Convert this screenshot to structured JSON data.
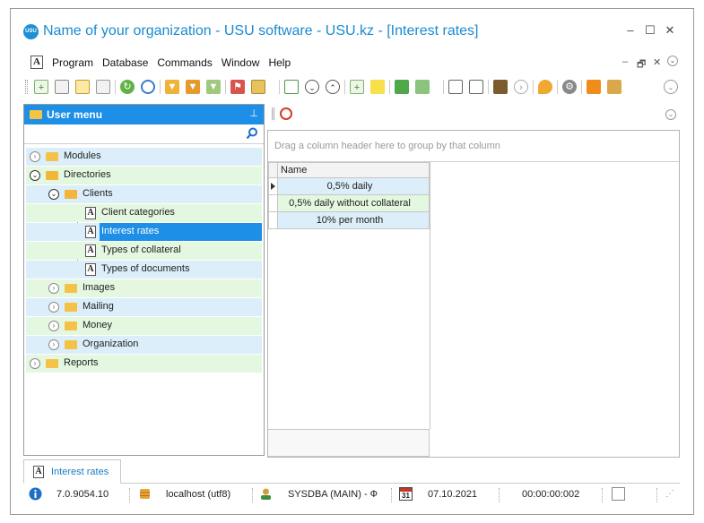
{
  "window": {
    "title": "Name of your organization - USU software - USU.kz - [Interest rates]",
    "logo_text": "USU",
    "controls": {
      "minimize": "–",
      "maximize": "☐",
      "close": "✕"
    }
  },
  "menu": {
    "doc_icon": "A",
    "items": [
      "Program",
      "Database",
      "Commands",
      "Window",
      "Help"
    ],
    "mdi_controls": {
      "minimize": "–",
      "restore": "🗗",
      "close": "✕",
      "extra": "⌄"
    }
  },
  "toolbar": {
    "icons": [
      "add-icon",
      "copy-icon",
      "edit-icon",
      "delete-icon",
      "refresh-icon",
      "search-icon",
      "filter-icon",
      "filter-clear-icon",
      "filter-settings-icon",
      "flag-icon",
      "image-icon",
      "columns-icon",
      "expand-all-icon",
      "collapse-all-icon",
      "add-child-icon",
      "note-icon",
      "export-icon",
      "import-icon",
      "new-window-icon",
      "close-window-icon",
      "exit-icon",
      "forward-icon",
      "location-icon",
      "settings-icon",
      "rss-icon",
      "users-icon"
    ]
  },
  "user_menu": {
    "title": "User menu",
    "pin": "📌",
    "items": [
      {
        "label": "Modules",
        "level": 0,
        "type": "folder",
        "expanded": false
      },
      {
        "label": "Directories",
        "level": 0,
        "type": "folder",
        "expanded": true
      },
      {
        "label": "Clients",
        "level": 1,
        "type": "folder",
        "expanded": true
      },
      {
        "label": "Client categories",
        "level": 2,
        "type": "doc"
      },
      {
        "label": "Interest rates",
        "level": 2,
        "type": "doc",
        "selected": true
      },
      {
        "label": "Types of collateral",
        "level": 2,
        "type": "doc"
      },
      {
        "label": "Types of documents",
        "level": 2,
        "type": "doc"
      },
      {
        "label": "Images",
        "level": 1,
        "type": "folder",
        "expanded": false
      },
      {
        "label": "Mailing",
        "level": 1,
        "type": "folder",
        "expanded": false
      },
      {
        "label": "Money",
        "level": 1,
        "type": "folder",
        "expanded": false
      },
      {
        "label": "Organization",
        "level": 1,
        "type": "folder",
        "expanded": false
      },
      {
        "label": "Reports",
        "level": 0,
        "type": "folder",
        "expanded": false
      }
    ]
  },
  "grid": {
    "group_hint": "Drag a column header here to group by that column",
    "column": "Name",
    "rows": [
      "0,5% daily",
      "0,5% daily without collateral",
      "10% per month"
    ]
  },
  "doc_tab": {
    "label": "Interest rates",
    "icon": "A"
  },
  "status": {
    "version": "7.0.9054.10",
    "server": "localhost (utf8)",
    "user": "SYSDBA (MAIN) - Ф",
    "date": "07.10.2021",
    "timer": "00:00:00:002",
    "calendar_day": "31"
  },
  "colors": {
    "accent": "#1d8fe6",
    "title_text": "#1a8bd0",
    "row_blue": "#dbeef9",
    "row_green": "#e4f7e0",
    "folder": "#f4c247"
  }
}
